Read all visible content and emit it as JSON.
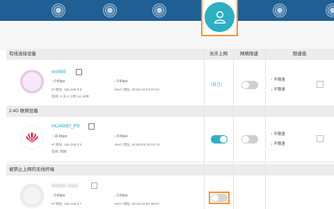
{
  "table": {
    "columns": {
      "allow": "允许上网",
      "limit": "网络限速",
      "value": "限速值"
    }
  },
  "sections": {
    "wired": "有线连接设备",
    "wifi24": "2.4G 联网设备",
    "blocked": "被禁止上网的无线终端"
  },
  "devices": [
    {
      "name": "wx888",
      "up": "0 Kbps",
      "down": "0 Kbps",
      "ip": "IP 地址: 192.168.3.5",
      "mac": "MAC 地址: 30:05:C5:F2:07:0A",
      "online": "在线: 0 天 0 小时 53 分钟",
      "allow_label": "(自己)",
      "limit_up": "不限速",
      "limit_down": "不限速"
    },
    {
      "name": "HUAWEI_P9",
      "up": "16 Kbps",
      "down": "8 Kbps",
      "ip": "IP 地址: 192.168.3.4",
      "mac": "MAC 地址: 44:6E:E5:30:A1:10",
      "online": "在线: 刚刚",
      "limit_up": "不限速",
      "limit_down": "不限速"
    },
    {
      "name": "MI8SE-HAN",
      "up": "0 Kbps",
      "down": "0 Kbps",
      "ip": "IP 地址: 192.168.3.7",
      "mac": "MAC 地址: 68:3E:34:5F:4B:87"
    }
  ],
  "colors": {
    "teal": "#2bb0c3",
    "header": "#1f5f93",
    "highlight": "#ff8c2a",
    "huawei": "#e0203f"
  }
}
